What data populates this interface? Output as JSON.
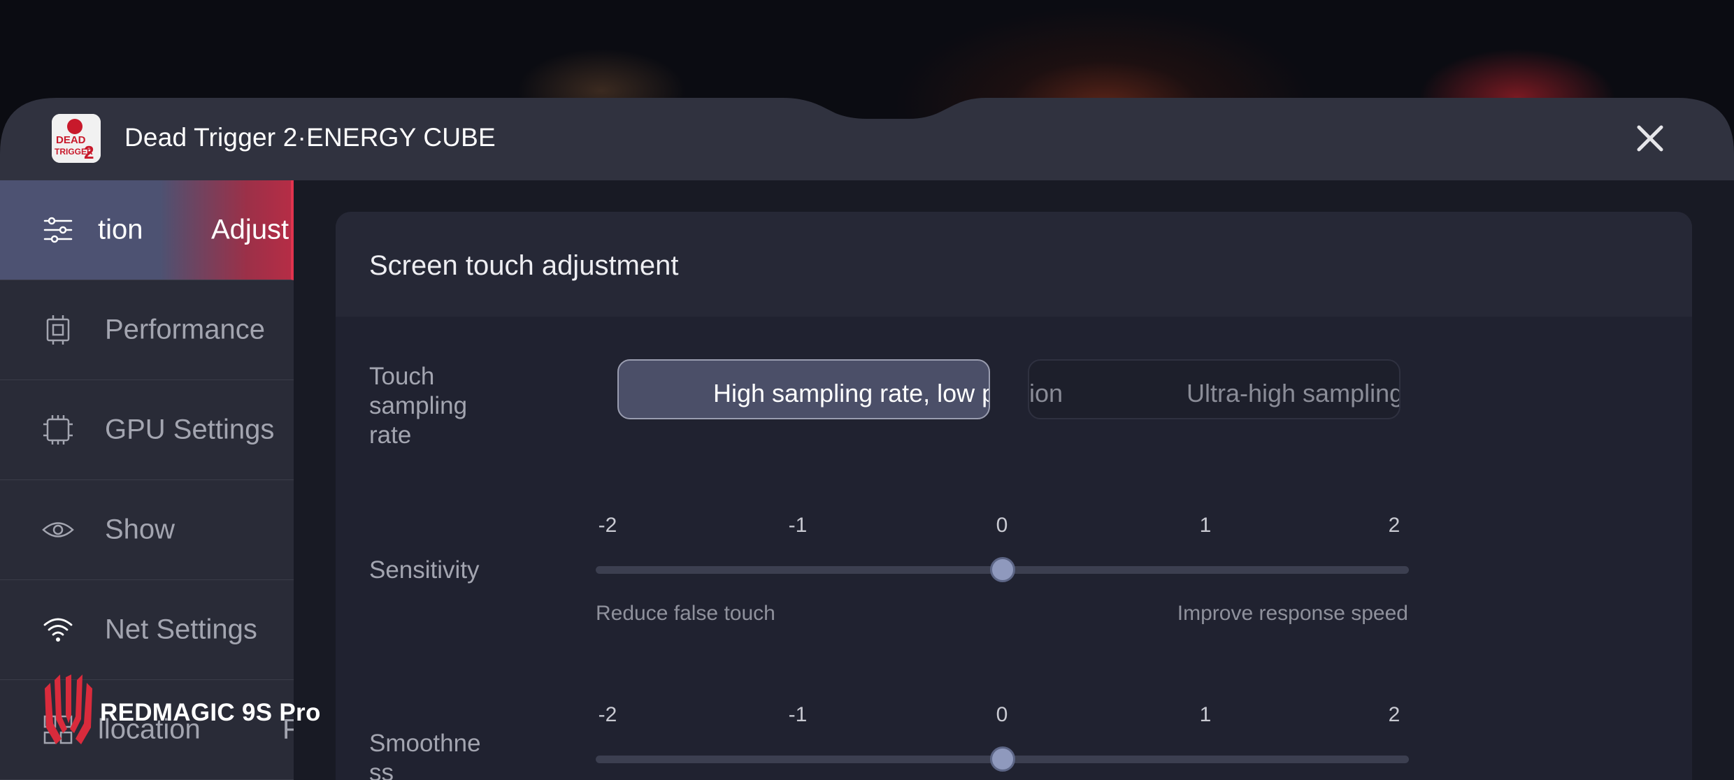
{
  "header": {
    "app_title": "Dead Trigger 2·ENERGY CUBE"
  },
  "sidebar": {
    "active_marquee_left": "tion",
    "active_marquee_right": "Adjust",
    "items": [
      {
        "label": "Performance",
        "icon": "performance-chip-icon"
      },
      {
        "label": "GPU Settings",
        "icon": "gpu-chip-icon"
      },
      {
        "label": "Show",
        "icon": "eye-icon"
      },
      {
        "label": "Net Settings",
        "icon": "wifi-icon"
      },
      {
        "label": "llocation",
        "trailing": "F",
        "icon": "grid-icon"
      }
    ]
  },
  "main": {
    "card_title": "Screen touch adjustment",
    "touch_sampling": {
      "label": "Touch sampling rate",
      "label_lines": [
        "Touch",
        "sampling",
        "rate"
      ],
      "selected_option": "High sampling rate, low p",
      "option_2_fragment": "ion",
      "option_3": "Ultra-high sampling"
    },
    "sensitivity": {
      "label": "Sensitivity",
      "ticks": [
        "-2",
        "-1",
        "0",
        "1",
        "2"
      ],
      "value": 0,
      "min_hint": "Reduce false touch",
      "max_hint": "Improve response speed"
    },
    "smoothness": {
      "label_lines": [
        "Smoothne",
        "ss"
      ],
      "ticks": [
        "-2",
        "-1",
        "0",
        "1",
        "2"
      ],
      "value": 0
    }
  },
  "watermark": {
    "text": "REDMAGIC 9S Pro"
  },
  "colors": {
    "accent_red": "#e0334e",
    "panel_header": "#30323f",
    "sidebar": "#292b37",
    "card": "#202230"
  }
}
